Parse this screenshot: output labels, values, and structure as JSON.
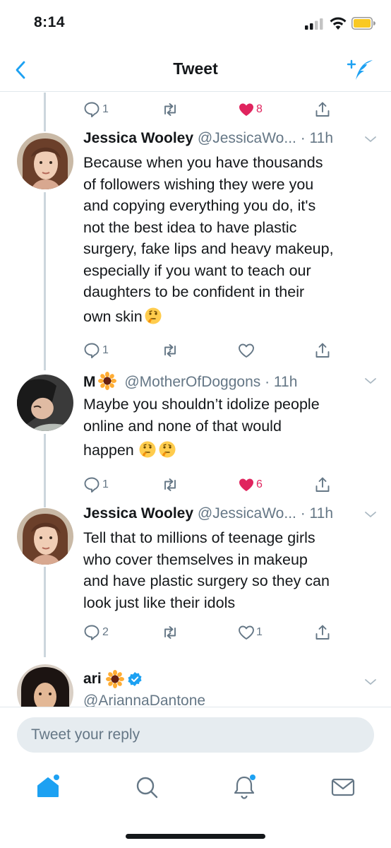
{
  "status_bar": {
    "time": "8:14"
  },
  "nav": {
    "title": "Tweet"
  },
  "top_actions": {
    "reply_count": "1",
    "like_count": "8"
  },
  "tweets": [
    {
      "name": "Jessica Wooley",
      "handle": "@JessicaWo...",
      "time": "· 11h",
      "lines": [
        "Because when you have thousands",
        "of followers wishing they were you",
        "and copying everything you do, it's",
        "not the best idea to have plastic",
        "surgery, fake lips and heavy makeup,",
        "especially if you want to teach our",
        "daughters to be confident in their",
        "own skin"
      ],
      "reply_count": "1",
      "like_count": ""
    },
    {
      "name": "M",
      "handle": "@MotherOfDoggons",
      "time": "· 11h",
      "lines": [
        "Maybe you shouldn’t idolize people",
        "online and none of that would",
        "happen"
      ],
      "reply_count": "1",
      "like_count": "6"
    },
    {
      "name": "Jessica Wooley",
      "handle": "@JessicaWo...",
      "time": "· 11h",
      "lines": [
        "Tell that to millions of teenage girls",
        "who cover themselves in makeup",
        "and have plastic surgery so they can",
        "look just like their idols"
      ],
      "reply_count": "2",
      "like_count": "1"
    }
  ],
  "last_tweet": {
    "name": "ari",
    "handle": "@AriannaDantone"
  },
  "reply_box": {
    "placeholder": "Tweet your reply"
  },
  "colors": {
    "accent": "#1da1f2",
    "like": "#e0245e",
    "muted": "#657786",
    "text": "#14171a"
  },
  "icons": {
    "nav": [
      "back-chevron-icon",
      "compose-tweet-icon"
    ],
    "actions": [
      "reply-icon",
      "retweet-icon",
      "like-icon",
      "share-icon"
    ],
    "tabs": [
      "home-icon",
      "search-icon",
      "notifications-icon",
      "messages-icon"
    ]
  }
}
